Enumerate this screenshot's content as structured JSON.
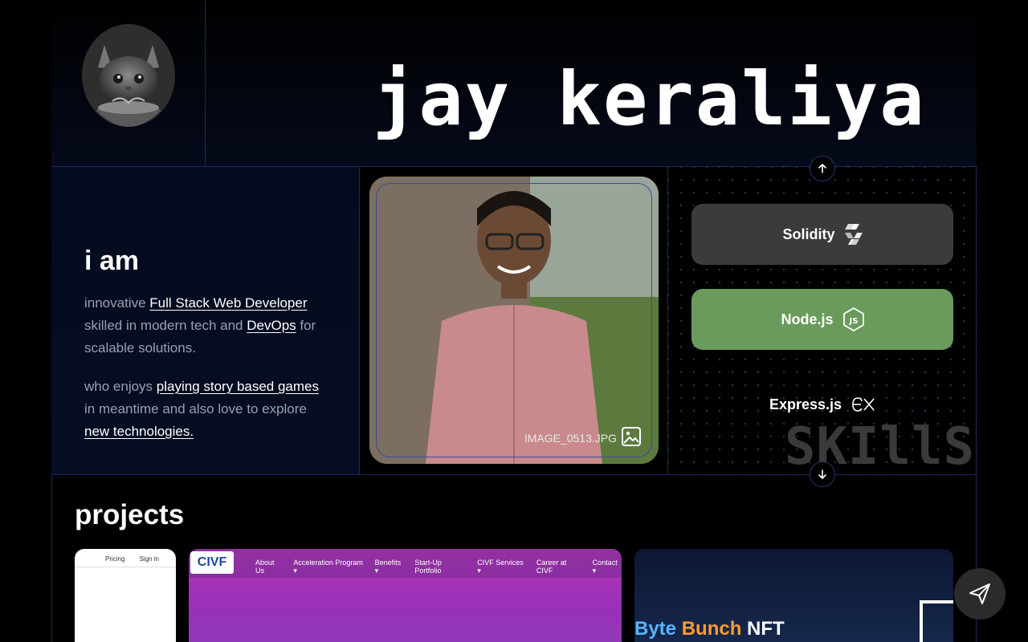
{
  "header": {
    "name": "jay keraliya"
  },
  "about": {
    "heading": "i am",
    "bio1": {
      "pre": "innovative ",
      "link1": "Full Stack Web Developer",
      "mid": " skilled in modern tech and ",
      "link2": "DevOps",
      "post": " for scalable solutions."
    },
    "bio2": {
      "pre": "who enjoys ",
      "link1": "playing story based games",
      "mid": " in meantime and also love to explore",
      "link2": " new technologies."
    }
  },
  "photo": {
    "caption": "IMAGE_0513.JPG"
  },
  "skills": {
    "items": [
      {
        "label": "Solidity",
        "icon": "solidity-icon",
        "color": "#3b3b3b"
      },
      {
        "label": "Node.js",
        "icon": "nodejs-icon",
        "color": "#6a9b5c"
      },
      {
        "label": "Express.js",
        "icon": "express-icon",
        "color": "transparent"
      }
    ],
    "watermark": "SKIllS"
  },
  "projects": {
    "title": "projects",
    "card1": {
      "nav": [
        "Pricing",
        "Sign in"
      ]
    },
    "card2": {
      "logo": "CIVF",
      "nav": [
        "About Us",
        "Acceleration Program ▾",
        "Benefits ▾",
        "Start-Up Portfolio",
        "CIVF Services ▾",
        "Career at CIVF",
        "Contact ▾"
      ]
    },
    "card3": {
      "title_part1": "Byte",
      "title_part2": " Bunch",
      "title_part3": " NFT"
    }
  }
}
